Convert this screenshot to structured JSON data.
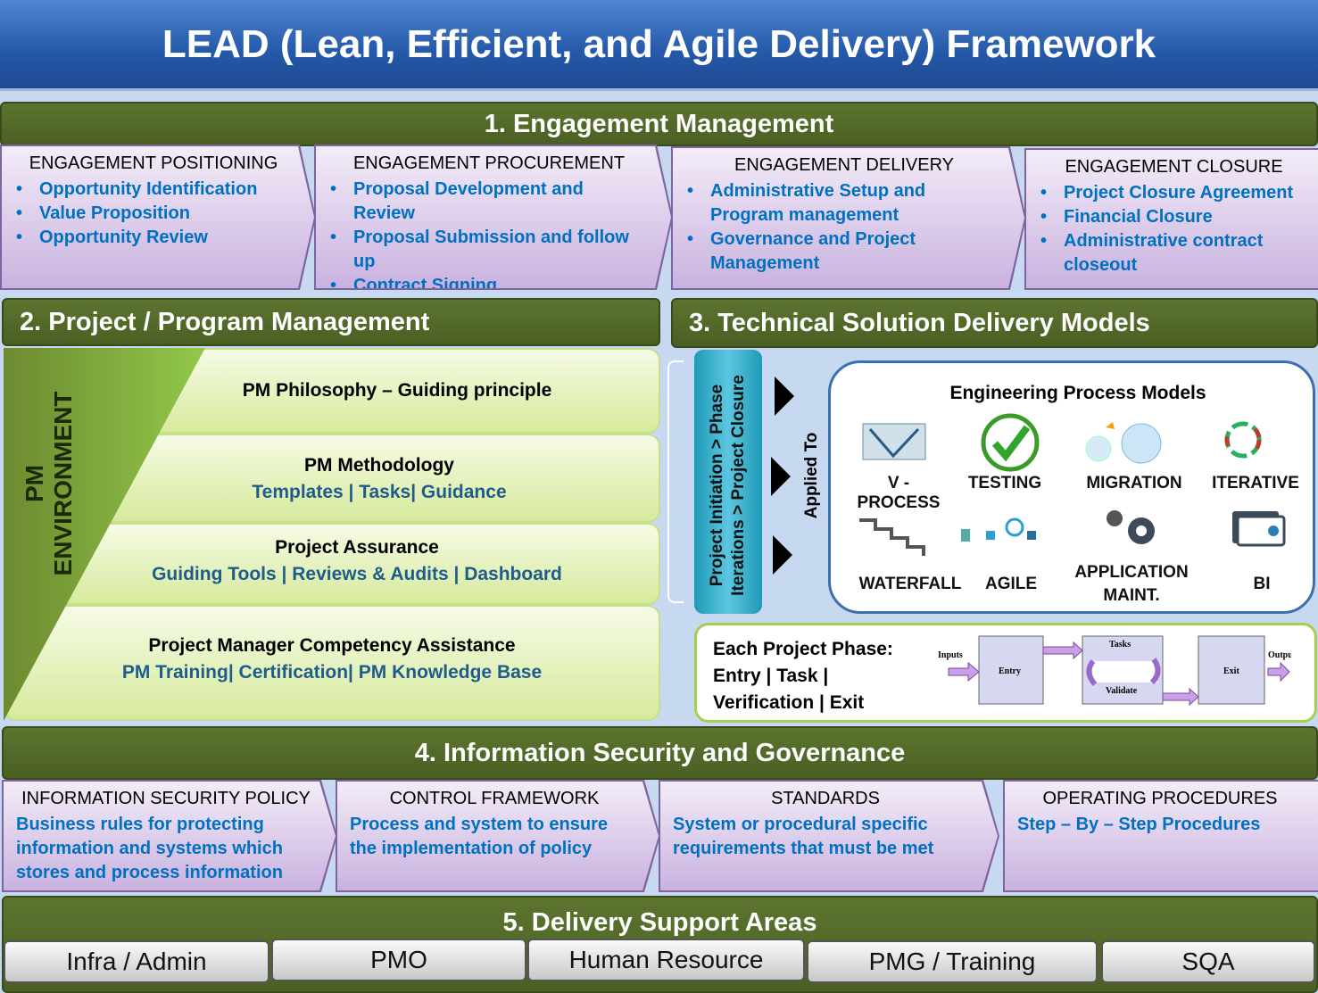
{
  "title": "LEAD (Lean, Efficient, and Agile Delivery) Framework",
  "engagement": {
    "header": "1. Engagement Management",
    "stages": [
      {
        "title": "ENGAGEMENT POSITIONING",
        "items": [
          "Opportunity Identification",
          "Value Proposition",
          "Opportunity Review"
        ]
      },
      {
        "title": "ENGAGEMENT PROCUREMENT",
        "items": [
          "Proposal Development and Review",
          "Proposal Submission and follow up",
          "Contract Signing"
        ]
      },
      {
        "title": "ENGAGEMENT DELIVERY",
        "items": [
          "Administrative Setup and Program management",
          "Governance and Project Management"
        ]
      },
      {
        "title": "ENGAGEMENT CLOSURE",
        "items": [
          "Project Closure Agreement",
          "Financial Closure",
          "Administrative contract closeout"
        ]
      }
    ]
  },
  "pm": {
    "header": "2. Project / Program Management",
    "environment": "PM ENVIRONMENT",
    "panels": [
      {
        "title": "PM Philosophy – Guiding principle",
        "sub": ""
      },
      {
        "title": "PM Methodology",
        "sub": "Templates | Tasks| Guidance"
      },
      {
        "title": "Project Assurance",
        "sub": "Guiding Tools | Reviews & Audits | Dashboard"
      },
      {
        "title": "Project Manager Competency Assistance",
        "sub": "PM Training| Certification| PM Knowledge Base"
      }
    ]
  },
  "tech": {
    "header": "3. Technical Solution Delivery Models",
    "phase_line1": "Project Initiation > Phase",
    "phase_line2": "Iterations > Project Closure",
    "applied_to": "Applied To",
    "models_title": "Engineering Process Models",
    "models": [
      "V - PROCESS",
      "TESTING",
      "MIGRATION",
      "ITERATIVE",
      "WATERFALL",
      "AGILE",
      "APPLICATION MAINT.",
      "BI"
    ],
    "phase_text": [
      "Each Project Phase:",
      "Entry | Task |",
      "Verification | Exit"
    ],
    "phase_diagram": {
      "inputs": "Inputs",
      "entry": "Entry",
      "tasks": "Tasks",
      "validate": "Validate",
      "exit": "Exit",
      "outputs": "Outputs"
    }
  },
  "security": {
    "header": "4. Information Security and Governance",
    "stages": [
      {
        "title": "INFORMATION SECURITY POLICY",
        "text": "Business rules for protecting information and systems which stores and process information"
      },
      {
        "title": "CONTROL FRAMEWORK",
        "text": "Process and system to ensure the implementation of policy"
      },
      {
        "title": "STANDARDS",
        "text": "System or procedural specific requirements that must be met"
      },
      {
        "title": "OPERATING PROCEDURES",
        "text": "Step – By – Step Procedures"
      }
    ]
  },
  "support": {
    "header": "5. Delivery Support Areas",
    "items": [
      "Infra / Admin",
      "PMO",
      "Human Resource",
      "PMG / Training",
      "SQA"
    ]
  },
  "colors": {
    "title_blue": "#2458a8",
    "header_green": "#4f6228",
    "link_blue": "#0070c0",
    "chevron_border": "#8064a2",
    "background": "#c6d9f1"
  }
}
